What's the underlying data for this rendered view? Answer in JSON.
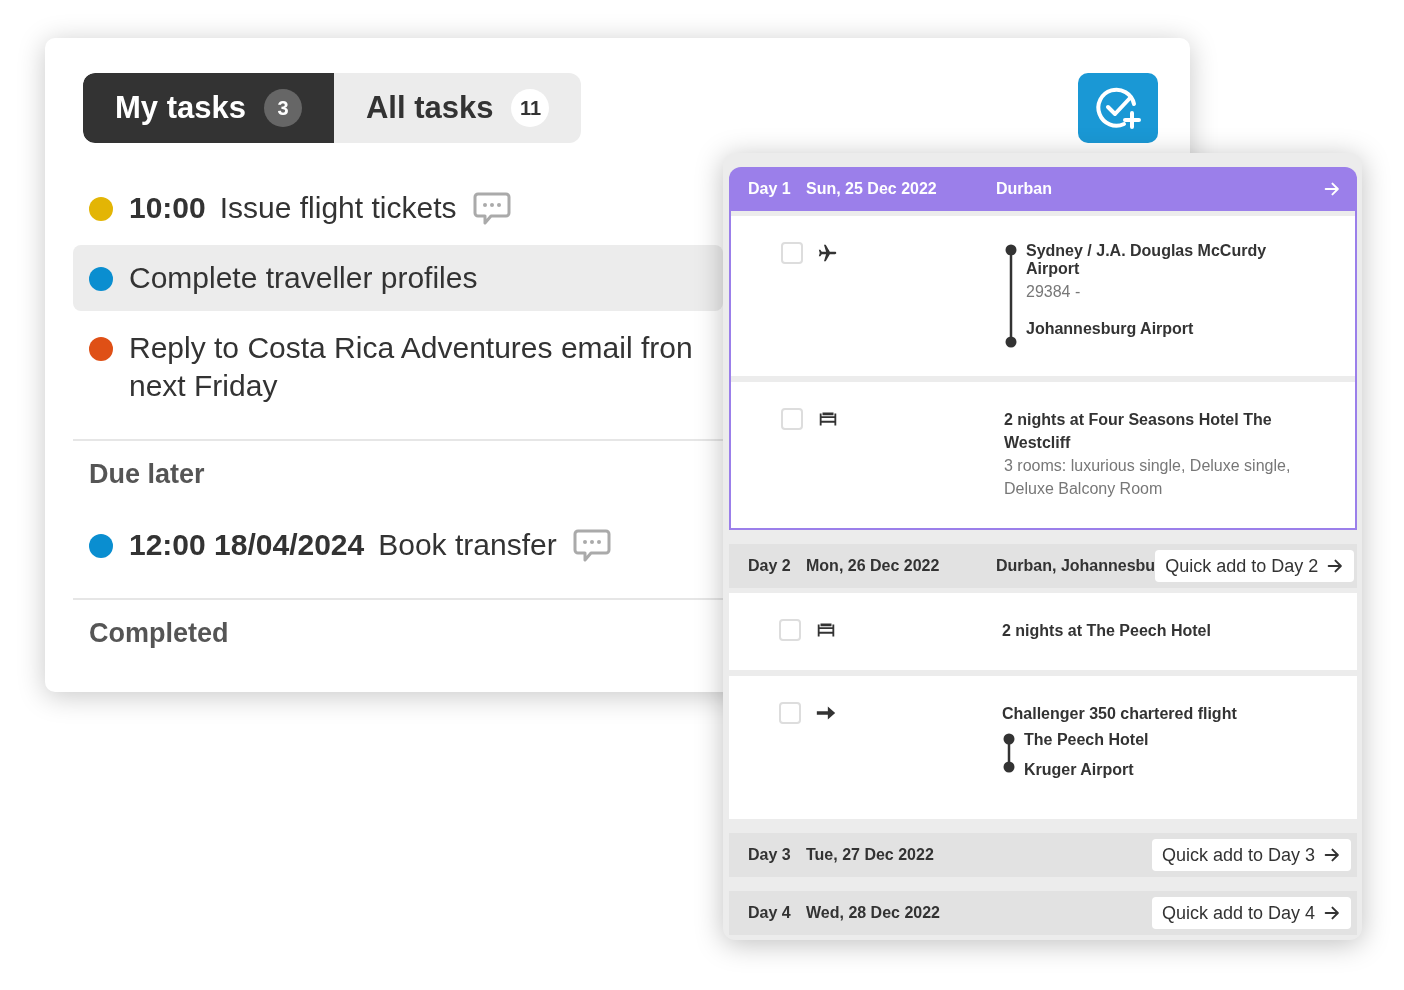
{
  "tasks_panel": {
    "tabs": [
      {
        "label": "My tasks",
        "count": "3",
        "selected": true
      },
      {
        "label": "All tasks",
        "count": "11",
        "selected": false
      }
    ],
    "tasks": [
      {
        "color": "#e3b505",
        "time": "10:00",
        "lines": [
          "Issue flight tickets"
        ],
        "has_comment": true,
        "selected": false
      },
      {
        "color": "#0a8ed0",
        "lines": [
          "Complete traveller profiles"
        ],
        "has_comment": false,
        "selected": true
      },
      {
        "color": "#df5016",
        "lines": [
          "Reply to Costa Rica Adventures email fron",
          "next Friday"
        ],
        "has_comment": false,
        "selected": false
      }
    ],
    "sections": [
      {
        "title": "Due later",
        "tasks": [
          {
            "color": "#0a8ed0",
            "time": "12:00 18/04/2024",
            "lines": [
              "Book transfer"
            ],
            "has_comment": true,
            "selected": false
          }
        ]
      },
      {
        "title": "Completed"
      }
    ]
  },
  "itinerary": {
    "days": [
      {
        "day": "Day 1",
        "date": "Sun, 25 Dec 2022",
        "location": "Durban",
        "selected": true,
        "items": [
          {
            "kind": "flight",
            "checked": false,
            "stops": [
              {
                "name": "Sydney / J.A. Douglas McCurdy Airport",
                "detail": "29384 -"
              },
              {
                "name": "Johannesburg Airport"
              }
            ]
          },
          {
            "kind": "hotel",
            "checked": false,
            "title": "2 nights at Four Seasons Hotel The Westcliff",
            "subtitle": "3 rooms: luxurious single, Deluxe single, Deluxe Balcony Room"
          }
        ]
      },
      {
        "day": "Day 2",
        "date": "Mon, 26 Dec 2022",
        "location": "Durban, Johannesbu",
        "selected": false,
        "quick_add": "Quick add to Day 2",
        "items": [
          {
            "kind": "hotel",
            "checked": false,
            "title": "2 nights at The Peech Hotel"
          },
          {
            "kind": "transfer",
            "checked": false,
            "title": "Challenger 350 chartered flight",
            "stops": [
              {
                "name": "The Peech Hotel"
              },
              {
                "name": "Kruger Airport"
              }
            ]
          }
        ]
      },
      {
        "day": "Day 3",
        "date": "Tue, 27 Dec 2022",
        "selected": false,
        "quick_add": "Quick add to Day 3"
      },
      {
        "day": "Day 4",
        "date": "Wed, 28 Dec 2022",
        "selected": false,
        "quick_add": "Quick add to Day 4"
      }
    ]
  }
}
